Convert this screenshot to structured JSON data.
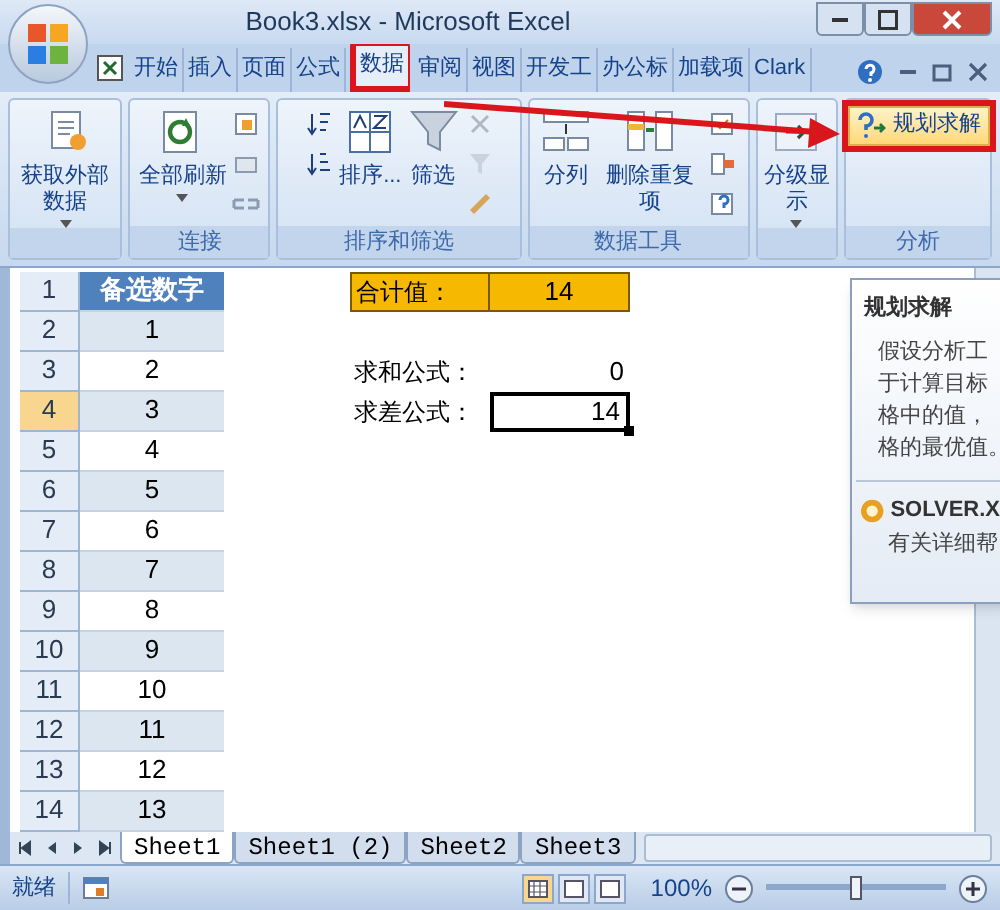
{
  "window": {
    "title": "Book3.xlsx - Microsoft Excel"
  },
  "tabs": [
    {
      "label": "开始",
      "selected": false,
      "highlighted": false
    },
    {
      "label": "插入",
      "selected": false,
      "highlighted": false
    },
    {
      "label": "页面",
      "selected": false,
      "highlighted": false
    },
    {
      "label": "公式",
      "selected": false,
      "highlighted": false
    },
    {
      "label": "数据",
      "selected": true,
      "highlighted": true
    },
    {
      "label": "审阅",
      "selected": false,
      "highlighted": false
    },
    {
      "label": "视图",
      "selected": false,
      "highlighted": false
    },
    {
      "label": "开发工",
      "selected": false,
      "highlighted": false
    },
    {
      "label": "办公标",
      "selected": false,
      "highlighted": false
    },
    {
      "label": "加载项",
      "selected": false,
      "highlighted": false
    },
    {
      "label": "Clark",
      "selected": false,
      "highlighted": false
    }
  ],
  "ribbon": [
    {
      "items": [
        {
          "kind": "large",
          "label": "获取外部数据",
          "dropdown": true
        }
      ]
    },
    {
      "label": "连接",
      "items": [
        {
          "kind": "large",
          "label": "全部刷新",
          "dropdown": true
        },
        {
          "kind": "smallstack"
        }
      ]
    },
    {
      "label": "排序和筛选",
      "items": [
        {
          "kind": "smallstack"
        },
        {
          "kind": "large",
          "label": "排序...",
          "dropdown": false
        },
        {
          "kind": "large",
          "label": "筛选",
          "dropdown": false
        },
        {
          "kind": "smallstack"
        }
      ]
    },
    {
      "label": "数据工具",
      "items": [
        {
          "kind": "large",
          "label": "分列",
          "dropdown": false
        },
        {
          "kind": "large",
          "label": "删除重复项",
          "dropdown": false
        },
        {
          "kind": "smallstack"
        }
      ]
    },
    {
      "items": [
        {
          "kind": "large",
          "label": "分级显示",
          "dropdown": true
        }
      ]
    },
    {
      "label": "分析",
      "items": [
        {
          "kind": "small",
          "label": "规划求解",
          "highlighted": true
        }
      ]
    }
  ],
  "annotation": {
    "arrow": true
  },
  "rows": [
    {
      "header": "1",
      "selected": false,
      "b": "备选数字",
      "heading": true,
      "d": "合计值：",
      "e": "14",
      "kind": "total"
    },
    {
      "header": "2",
      "selected": false,
      "b": "1"
    },
    {
      "header": "3",
      "selected": false,
      "b": "2",
      "d": "求和公式：",
      "e": "0",
      "kind": "formula",
      "active": false
    },
    {
      "header": "4",
      "selected": true,
      "b": "3",
      "d": "求差公式：",
      "e": "14",
      "kind": "formula",
      "active": true
    },
    {
      "header": "5",
      "selected": false,
      "b": "4"
    },
    {
      "header": "6",
      "selected": false,
      "b": "5"
    },
    {
      "header": "7",
      "selected": false,
      "b": "6"
    },
    {
      "header": "8",
      "selected": false,
      "b": "7"
    },
    {
      "header": "9",
      "selected": false,
      "b": "8"
    },
    {
      "header": "10",
      "selected": false,
      "b": "9"
    },
    {
      "header": "11",
      "selected": false,
      "b": "10"
    },
    {
      "header": "12",
      "selected": false,
      "b": "11"
    },
    {
      "header": "13",
      "selected": false,
      "b": "12"
    },
    {
      "header": "14",
      "selected": false,
      "b": "13"
    }
  ],
  "tooltip": {
    "title": "规划求解",
    "lines": [
      "假设分析工",
      "于计算目标",
      "格中的值，",
      "格的最优值。"
    ],
    "footer_title": "SOLVER.X",
    "footer_text": "有关详细帮"
  },
  "sheet_tabs": [
    {
      "label": "Sheet1",
      "selected": true
    },
    {
      "label": "Sheet1 (2)",
      "selected": false
    },
    {
      "label": "Sheet2",
      "selected": false
    },
    {
      "label": "Sheet3",
      "selected": false
    }
  ],
  "status_bar": {
    "text": "就绪",
    "zoom": "100%",
    "level": 0.5
  }
}
